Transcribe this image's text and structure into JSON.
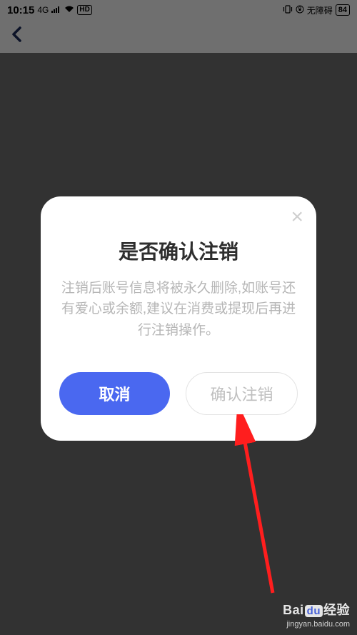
{
  "status": {
    "time": "10:15",
    "network_4g": "4G",
    "signal": "▮▮▮▮",
    "wifi": "▲",
    "hd": "HD",
    "vibrate": "📳",
    "lock": "🔒",
    "accessibility": "无障碍",
    "battery": "84"
  },
  "nav": {
    "back_icon": "back-chevron"
  },
  "modal": {
    "close_label": "×",
    "title": "是否确认注销",
    "body": "注销后账号信息将被永久删除,如账号还有爱心或余额,建议在消费或提现后再进行注销操作。",
    "cancel_label": "取消",
    "confirm_label": "确认注销"
  },
  "watermark": {
    "brand_prefix": "Bai",
    "brand_mid": "du",
    "brand_suffix": "经验",
    "url": "jingyan.baidu.com"
  },
  "colors": {
    "primary": "#4a68f0",
    "arrow": "#ff1e1e"
  }
}
